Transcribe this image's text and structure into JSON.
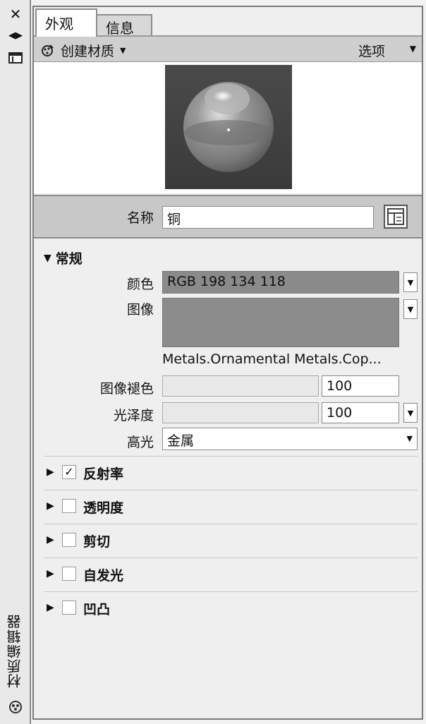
{
  "sidebar": {
    "vertical_title": "材质编辑器"
  },
  "tabs": [
    {
      "label": "外观"
    },
    {
      "label": "信息"
    }
  ],
  "toolbar": {
    "create_label": "创建材质",
    "options_label": "选项"
  },
  "material": {
    "name_label": "名称",
    "name_value": "铜"
  },
  "general": {
    "title": "常规",
    "color_label": "颜色",
    "color_value": "RGB 198 134 118",
    "image_label": "图像",
    "image_name": "Metals.Ornamental Metals.Cop...",
    "image_fade_label": "图像褪色",
    "image_fade_value": "100",
    "gloss_label": "光泽度",
    "gloss_value": "100",
    "highlight_label": "高光",
    "highlight_value": "金属"
  },
  "sections": [
    {
      "label": "反射率",
      "checked": true
    },
    {
      "label": "透明度",
      "checked": false
    },
    {
      "label": "剪切",
      "checked": false
    },
    {
      "label": "自发光",
      "checked": false
    },
    {
      "label": "凹凸",
      "checked": false
    }
  ]
}
